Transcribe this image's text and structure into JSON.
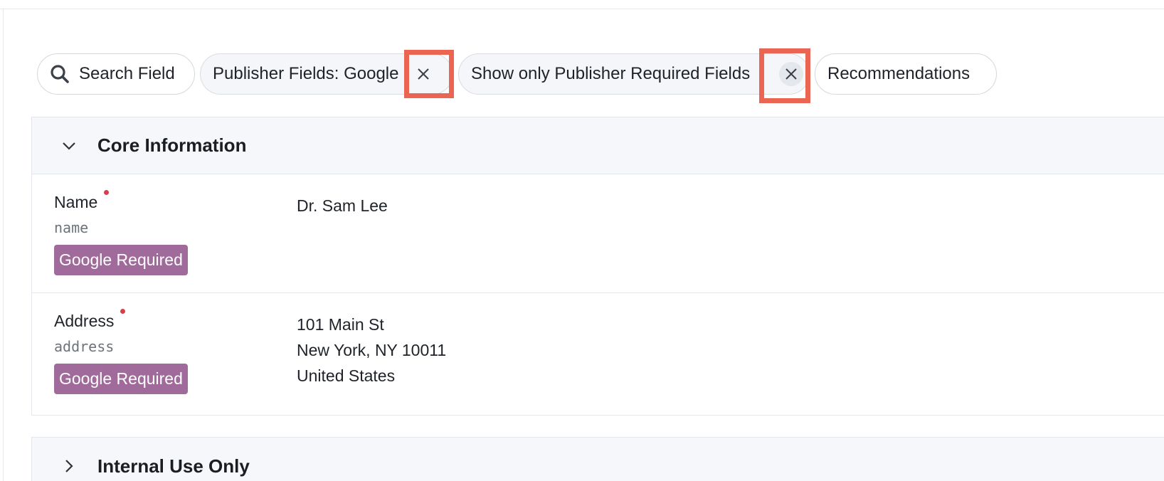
{
  "filters": {
    "search_label": "Search Field",
    "publisher_label": "Publisher Fields: Google",
    "required_label": "Show only Publisher Required Fields",
    "recommendations_label": "Recommendations"
  },
  "sections": {
    "core": {
      "title": "Core Information",
      "fields": [
        {
          "label": "Name",
          "key": "name",
          "badge": "Google Required",
          "value_lines": [
            "Dr. Sam Lee"
          ]
        },
        {
          "label": "Address",
          "key": "address",
          "badge": "Google Required",
          "value_lines": [
            "101 Main St",
            "New York, NY 10011",
            "United States"
          ]
        }
      ]
    },
    "internal": {
      "title": "Internal Use Only"
    }
  },
  "colors": {
    "badge": "#a06a9a",
    "required_dot": "#d6404c",
    "highlight": "#ea6552",
    "section_header_bg": "#f6f7fb"
  },
  "icons": {
    "search": "search-icon",
    "close": "close-icon",
    "expanded": "chevron-down-icon",
    "collapsed": "chevron-right-icon"
  }
}
